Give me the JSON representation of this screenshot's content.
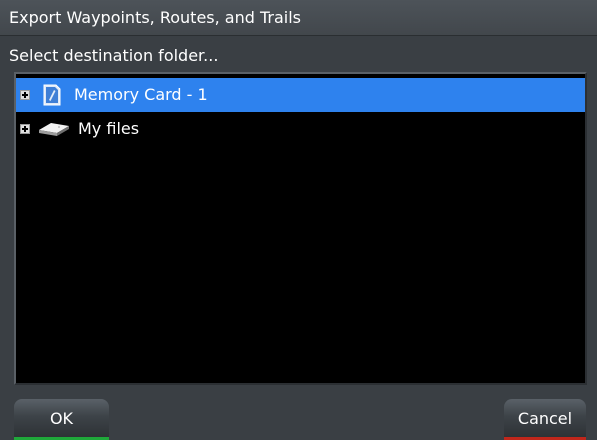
{
  "dialog": {
    "title": "Export Waypoints, Routes, and Trails",
    "prompt": "Select destination folder..."
  },
  "tree": {
    "items": [
      {
        "label": "Memory Card - 1",
        "icon": "memory-card-icon",
        "selected": true
      },
      {
        "label": "My files",
        "icon": "drive-icon",
        "selected": false
      }
    ]
  },
  "buttons": {
    "ok_label": "OK",
    "cancel_label": "Cancel"
  },
  "colors": {
    "selection": "#2e82ee",
    "ok_accent": "#1fa83a",
    "cancel_accent": "#c0261b"
  }
}
